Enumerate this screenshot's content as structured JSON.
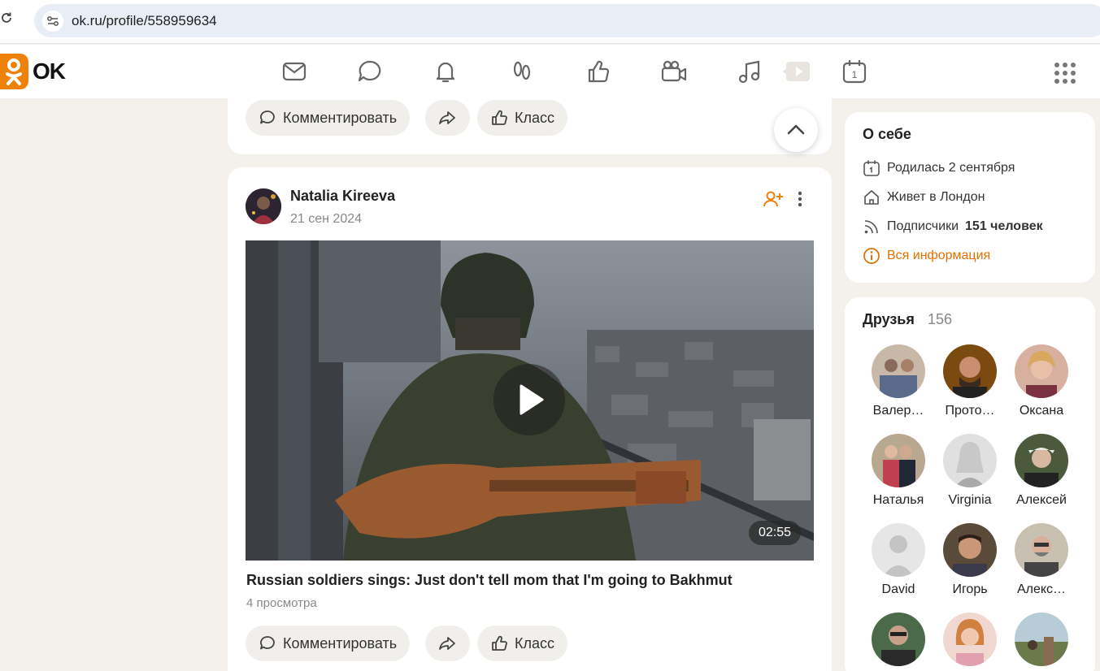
{
  "browser": {
    "url": "ok.ru/profile/558959634"
  },
  "header": {
    "logo_text": "OK",
    "nav_icons": [
      "mail-icon",
      "chat-icon",
      "bell-icon",
      "guests-icon",
      "likes-icon",
      "video-camera-icon",
      "music-icon",
      "video-icon",
      "calendar-icon"
    ],
    "calendar_day": "1"
  },
  "feed": {
    "prev_post": {
      "comment_label": "Комментировать",
      "like_label": "Класс"
    },
    "post": {
      "author": "Natalia Kireeva",
      "date": "21 сен 2024",
      "video_duration": "02:55",
      "video_title": "Russian soldiers sings: Just don't tell mom that I'm going to Bakhmut",
      "views": "4 просмотра",
      "comment_label": "Комментировать",
      "like_label": "Класс"
    }
  },
  "about": {
    "title": "О себе",
    "birthday": "Родилась 2 сентября",
    "lives": "Живет в Лондон",
    "subscribers_prefix": "Подписчики",
    "subscribers_count": "151 человек",
    "all_info": "Вся информация"
  },
  "friends": {
    "title": "Друзья",
    "count": "156",
    "items": [
      {
        "name": "Валер…"
      },
      {
        "name": "Прото…"
      },
      {
        "name": "Оксана"
      },
      {
        "name": "Наталья"
      },
      {
        "name": "Virginia"
      },
      {
        "name": "Алексей"
      },
      {
        "name": "David"
      },
      {
        "name": "Игорь"
      },
      {
        "name": "Алекс…"
      },
      {
        "name": ""
      },
      {
        "name": ""
      },
      {
        "name": ""
      }
    ]
  },
  "colors": {
    "accent": "#ee8208",
    "link": "#e07000",
    "page_bg": "#f4f1ed"
  }
}
